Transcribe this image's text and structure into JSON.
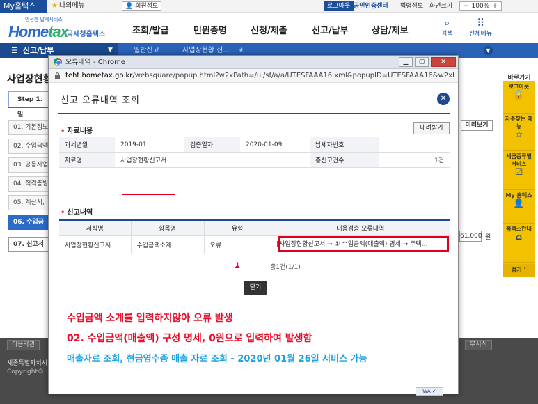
{
  "topbar": {
    "myhometax": "My홈택스",
    "mymenu": "나의메뉴",
    "member": "회원정보",
    "logout": "로그아웃",
    "cert": "공인인증센터",
    "law": "법령정보",
    "screen": "화면크기",
    "zoom": "100%"
  },
  "header": {
    "logo_sub": "안전한 납세서비스",
    "logo_home": "Home",
    "logo_x": "tax",
    "logo_nts": "국세청홈택스",
    "menu": [
      "조회/발급",
      "민원증명",
      "신청/제출",
      "신고/납부",
      "상담/제보"
    ],
    "search": "검색",
    "allmenu": "전체메뉴"
  },
  "nav": {
    "current": "신고/납부",
    "items": [
      "일반신고",
      "사업장현황 신고"
    ]
  },
  "page": {
    "title": "사업장현황",
    "step": "Step 1. 일",
    "side_items": [
      "01. 기본정보",
      "02. 수입금액",
      "03. 공동사업",
      "04. 적격증빙",
      "05. 계산서,",
      "06. 수입금",
      "07. 신고서"
    ],
    "preview": "미리보기",
    "amount": "61,000",
    "amount_unit": "원"
  },
  "footer": {
    "terms": "이용약관",
    "address": "세종특별자치시",
    "copyright": "Copyright©",
    "right_btn": "무서식"
  },
  "quick": {
    "title": "바로가기",
    "items": [
      "로그아웃",
      "자주찾는 메뉴",
      "세금종류별 서비스",
      "My 홈택스",
      "홈택스안내"
    ],
    "close": "접기"
  },
  "popup": {
    "window_title": "오류내역 - Chrome",
    "url_host": "teht.hometax.go.kr",
    "url_path": "/websquare/popup.html?w2xPath=/ui/sf/a/a/UTESFAAA16.xml&popupID=UTESFAAA16&w2xHom...",
    "heading": "신고 오류내역 조회",
    "section1": "자료내용",
    "download": "내려받기",
    "info": {
      "tax_year_label": "과세년월",
      "tax_year": "2019-01",
      "verify_date_label": "검증일자",
      "verify_date": "2020-01-09",
      "taxpayer_no_label": "납세자번호",
      "taxpayer_no": "",
      "doc_name_label": "자료명",
      "doc_name": "사업장현황신고서",
      "total_errors_label": "총신고건수",
      "total_errors": "1건"
    },
    "section2": "신고내역",
    "err_headers": [
      "서식명",
      "항목명",
      "유형",
      "내용검증 오류내역"
    ],
    "err_rows": [
      {
        "form": "사업장현황신고서",
        "item": "수입금액소계",
        "type": "오류",
        "detail": "[사업장현황신고서 → ① 수입금액(매출액) 명세 → 주택…"
      }
    ],
    "pager_current": "1",
    "pager_total": "총1건(1/1)",
    "close_button": "닫기",
    "note1": "수입금액 소계를 입력하지않아 오류 발생",
    "note2": "02. 수입금액(매출액) 구성 명세, 0원으로 입력하여 발생함",
    "note3": "매출자료 조회, 현금영수증 매출 자료 조회 - 2020년 01월 26일 서비스 가능"
  }
}
